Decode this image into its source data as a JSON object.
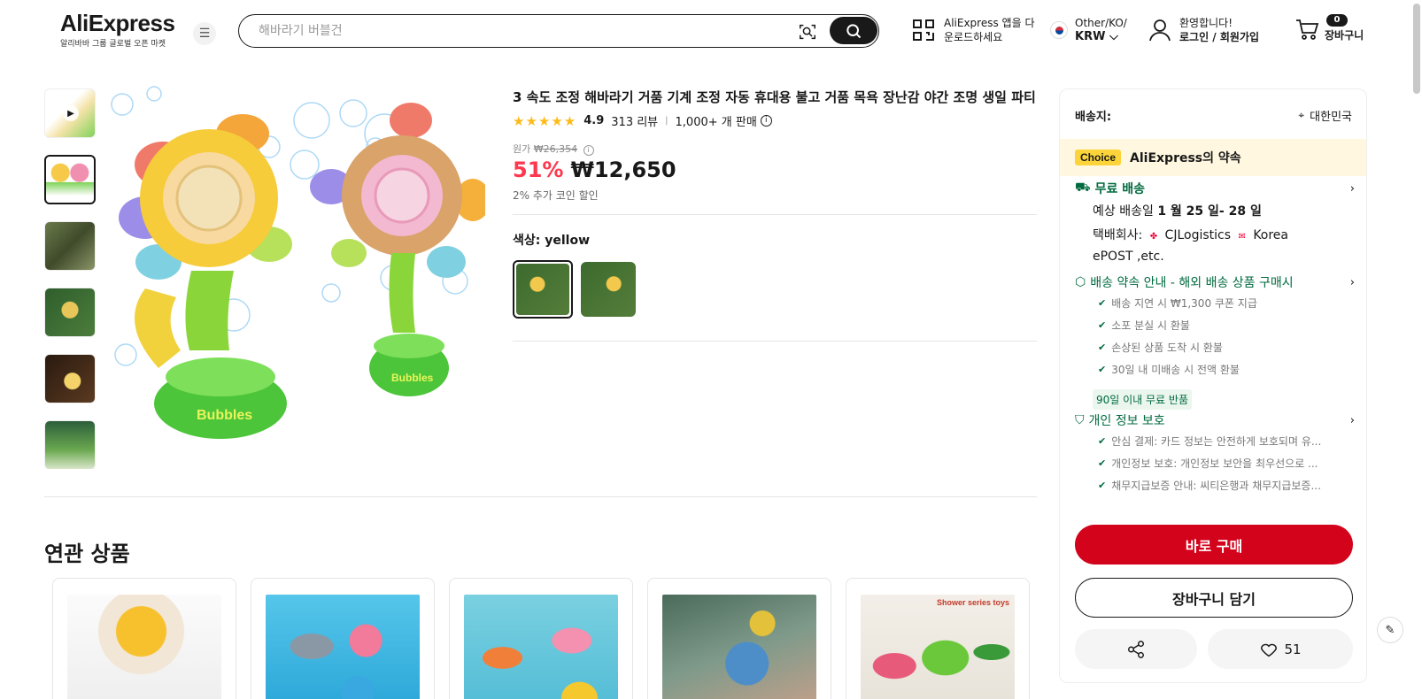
{
  "header": {
    "logo": "AliExpress",
    "logo_sub": "알리바바 그룹 글로벌 오픈 마켓",
    "search_placeholder": "해바라기 버블건",
    "app_download_line1": "AliExpress 앱을 다",
    "app_download_line2": "운로드하세요",
    "region_line1": "Other/KO/",
    "region_line2": "KRW",
    "user_line1": "환영합니다!",
    "user_line2": "로그인 / 회원가입",
    "cart_count": "0",
    "cart_label": "장바구니"
  },
  "product": {
    "title": "3 속도 조정 해바라기 거품 기계 조정 자동 휴대용 불고 거품 목욕 장난감 야간 조명 생일 파티",
    "rating": "4.9",
    "reviews": "313 리뷰",
    "sold": "1,000+ 개 판매",
    "original_label": "원가",
    "original_price": "₩26,354",
    "discount": "51%",
    "price": "₩12,650",
    "coin_discount": "2% 추가 코인 할인",
    "color_label": "색상:",
    "color_value": "yellow",
    "image_text": "Bubbles"
  },
  "shipping": {
    "ship_to_label": "배송지:",
    "ship_to_value": "대한민국",
    "choice_tag": "Choice",
    "choice_text": "AliExpress의 약속",
    "free_shipping": "무료 배송",
    "eta_prefix": "예상 배송일",
    "eta_value": "1 월 25 일- 28 일",
    "carrier_prefix": "택배회사:",
    "carrier_1": "CJLogistics",
    "carrier_2": "Korea",
    "carrier_3": "ePOST ,etc.",
    "guarantee_title": "배송 약속 안내 - 해외 배송 상품 구매시",
    "guarantee_items": [
      "배송 지연 시 ₩1,300 쿠폰 지급",
      "소포 분실 시 환불",
      "손상된 상품 도착 시 환불",
      "30일 내 미배송 시 전액 환불"
    ],
    "return_tag": "90일 이내 무료 반품",
    "privacy_title": "개인 정보 보호",
    "privacy_items": [
      "안심 결제: 카드 정보는 안전하게 보호되며 유...",
      "개인정보 보호: 개인정보 보안을 최우선으로 ...",
      "채무지급보증 안내: 씨티은행과 채무지급보증..."
    ],
    "buy_now": "바로 구매",
    "add_to_cart": "장바구니 담기",
    "wishlist_count": "51"
  },
  "related": {
    "title": "연관 상품",
    "cards": [
      {
        "image": "sunflower-shower-toy"
      },
      {
        "image": "whale-bath-toys"
      },
      {
        "image": "clownfish-bath-toys"
      },
      {
        "image": "fountain-bath-toy"
      },
      {
        "image": "frog-shower-toys",
        "badge": "Shower series toys"
      }
    ]
  },
  "colors": {
    "accent_red": "#d3031c",
    "discount_red": "#fd384f",
    "green": "#016b3f",
    "star": "#fdbb1a",
    "choice_yellow": "#fcd43a"
  }
}
